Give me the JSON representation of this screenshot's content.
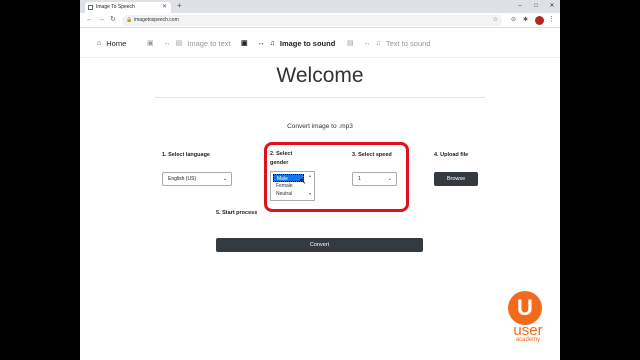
{
  "browser": {
    "tab_title": "Image To Speech",
    "new_tab": "+",
    "url": "imagetospeech.com",
    "window_controls": [
      "–",
      "□",
      "✕"
    ]
  },
  "nav": {
    "home": "Home",
    "image_to_text": "Image to text",
    "image_to_sound": "Image to sound",
    "text_to_sound": "Text to sound"
  },
  "main": {
    "title": "Welcome",
    "subtitle": "Convert image to .mp3",
    "step1_label": "1. Select language",
    "language_value": "English (US)",
    "step2_label": "2. Select gender",
    "gender_options": [
      "Male",
      "Female",
      "Neutral"
    ],
    "gender_selected": "Male",
    "step3_label": "3. Select speed",
    "speed_value": "1",
    "step4_label": "4. Upload file",
    "browse_label": "Browse",
    "step5_label": "5. Start process",
    "convert_label": "Convert"
  },
  "watermark": {
    "letter": "U",
    "brand": "user",
    "sub": "academy"
  },
  "colors": {
    "highlight": "#e0101c",
    "brand": "#f26a1b",
    "button_dark": "#343a40",
    "selected_option": "#1a73e8"
  }
}
